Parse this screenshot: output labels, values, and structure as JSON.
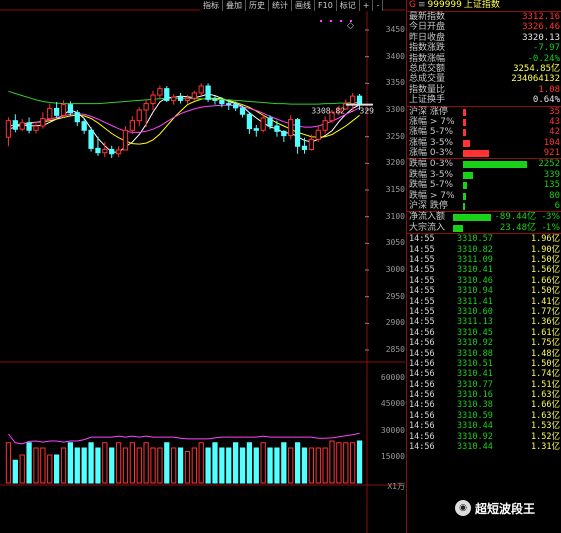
{
  "toolbar": [
    "指标",
    "叠加",
    "历史",
    "统计",
    "画线",
    "F10",
    "标记",
    "+",
    "-"
  ],
  "y_axis_main": [
    "3450",
    "3400",
    "3350",
    "3300",
    "3250",
    "3200",
    "3150",
    "3100",
    "3050",
    "3000",
    "2950",
    "2900",
    "2850"
  ],
  "y_axis_volume": [
    "60000",
    "45000",
    "30000",
    "15000",
    "X1万"
  ],
  "last_price_tag": "3308.82 - 329",
  "header": {
    "marker": "G",
    "code": "999999",
    "name": "上证指数"
  },
  "stats": [
    {
      "label": "最新指数",
      "value": "3312.16",
      "color": "red"
    },
    {
      "label": "今日开盘",
      "value": "3326.46",
      "color": "red"
    },
    {
      "label": "昨日收盘",
      "value": "3320.13",
      "color": "wht"
    },
    {
      "label": "指数涨跌",
      "value": "-7.97",
      "color": "grn"
    },
    {
      "label": "指数涨幅",
      "value": "-0.24%",
      "color": "grn"
    },
    {
      "label": "总成交额",
      "value": "3254.85亿",
      "color": "yel"
    },
    {
      "label": "总成交量",
      "value": "234064132",
      "color": "yel"
    },
    {
      "label": "指数量比",
      "value": "1.08",
      "color": "red"
    },
    {
      "label": "上证换手",
      "value": "0.64%",
      "color": "wht"
    }
  ],
  "breadth_up": [
    {
      "label": "沪深 涨停",
      "value": "35",
      "level": 0.04
    },
    {
      "label": "涨幅 > 7%",
      "value": "43",
      "level": 0.05
    },
    {
      "label": "涨幅 5-7%",
      "value": "42",
      "level": 0.05
    },
    {
      "label": "涨幅 3-5%",
      "value": "104",
      "level": 0.11
    },
    {
      "label": "涨幅 0-3%",
      "value": "921",
      "level": 0.41
    }
  ],
  "breadth_down": [
    {
      "label": "跌幅 0-3%",
      "value": "2252",
      "level": 1.0
    },
    {
      "label": "跌幅 3-5%",
      "value": "339",
      "level": 0.15
    },
    {
      "label": "跌幅 5-7%",
      "value": "135",
      "level": 0.06
    },
    {
      "label": "跌幅 > 7%",
      "value": "80",
      "level": 0.04
    },
    {
      "label": "沪深 跌停",
      "value": "6",
      "level": 0.01
    }
  ],
  "flows": [
    {
      "label": "净流入额",
      "value": "-89.44亿",
      "pct": "-3%",
      "level": 1.0
    },
    {
      "label": "大宗流入",
      "value": "23.48亿",
      "pct": "-1%",
      "level": 0.27
    }
  ],
  "ticks": [
    {
      "time": "14:55",
      "price": "3310.57",
      "vol": "1.96亿"
    },
    {
      "time": "14:55",
      "price": "3310.82",
      "vol": "1.90亿"
    },
    {
      "time": "14:55",
      "price": "3311.09",
      "vol": "1.50亿"
    },
    {
      "time": "14:55",
      "price": "3310.41",
      "vol": "1.56亿"
    },
    {
      "time": "14:55",
      "price": "3310.46",
      "vol": "1.66亿"
    },
    {
      "time": "14:55",
      "price": "3310.94",
      "vol": "1.50亿"
    },
    {
      "time": "14:55",
      "price": "3311.41",
      "vol": "1.41亿"
    },
    {
      "time": "14:55",
      "price": "3310.60",
      "vol": "1.77亿"
    },
    {
      "time": "14:55",
      "price": "3311.13",
      "vol": "1.36亿"
    },
    {
      "time": "14:56",
      "price": "3310.45",
      "vol": "1.61亿"
    },
    {
      "time": "14:56",
      "price": "3310.92",
      "vol": "1.75亿"
    },
    {
      "time": "14:56",
      "price": "3310.88",
      "vol": "1.48亿"
    },
    {
      "time": "14:56",
      "price": "3310.51",
      "vol": "1.50亿"
    },
    {
      "time": "14:56",
      "price": "3310.41",
      "vol": "1.74亿"
    },
    {
      "time": "14:56",
      "price": "3310.77",
      "vol": "1.51亿"
    },
    {
      "time": "14:56",
      "price": "3310.16",
      "vol": "1.63亿"
    },
    {
      "time": "14:56",
      "price": "3310.38",
      "vol": "1.66亿"
    },
    {
      "time": "14:56",
      "price": "3310.59",
      "vol": "1.63亿"
    },
    {
      "time": "14:56",
      "price": "3310.44",
      "vol": "1.53亿"
    },
    {
      "time": "14:56",
      "price": "3310.92",
      "vol": "1.52亿"
    },
    {
      "time": "14:56",
      "price": "3310.44",
      "vol": "1.31亿"
    }
  ],
  "watermark": "超短波段王",
  "colors": {
    "up": "#ff3333",
    "down": "#54ffff",
    "ma5": "#ffffff",
    "ma10": "#ffff00",
    "ma20": "#ff44ff",
    "ma60": "#33cc33",
    "grid": "#8a1010"
  },
  "chart_data": {
    "type": "candlestick",
    "price_range": [
      2850,
      3450
    ],
    "candles": [
      {
        "o": 3249,
        "c": 3280,
        "h": 3286,
        "l": 3232
      },
      {
        "o": 3280,
        "c": 3264,
        "h": 3292,
        "l": 3258
      },
      {
        "o": 3264,
        "c": 3276,
        "h": 3283,
        "l": 3260
      },
      {
        "o": 3276,
        "c": 3262,
        "h": 3286,
        "l": 3256
      },
      {
        "o": 3262,
        "c": 3270,
        "h": 3275,
        "l": 3256
      },
      {
        "o": 3270,
        "c": 3284,
        "h": 3296,
        "l": 3265
      },
      {
        "o": 3284,
        "c": 3303,
        "h": 3312,
        "l": 3280
      },
      {
        "o": 3303,
        "c": 3290,
        "h": 3315,
        "l": 3285
      },
      {
        "o": 3290,
        "c": 3310,
        "h": 3318,
        "l": 3286
      },
      {
        "o": 3310,
        "c": 3295,
        "h": 3316,
        "l": 3290
      },
      {
        "o": 3295,
        "c": 3278,
        "h": 3300,
        "l": 3270
      },
      {
        "o": 3278,
        "c": 3262,
        "h": 3285,
        "l": 3255
      },
      {
        "o": 3262,
        "c": 3228,
        "h": 3268,
        "l": 3222
      },
      {
        "o": 3228,
        "c": 3220,
        "h": 3250,
        "l": 3214
      },
      {
        "o": 3220,
        "c": 3226,
        "h": 3240,
        "l": 3212
      },
      {
        "o": 3226,
        "c": 3218,
        "h": 3233,
        "l": 3210
      },
      {
        "o": 3218,
        "c": 3225,
        "h": 3232,
        "l": 3212
      },
      {
        "o": 3225,
        "c": 3262,
        "h": 3270,
        "l": 3224
      },
      {
        "o": 3262,
        "c": 3280,
        "h": 3288,
        "l": 3255
      },
      {
        "o": 3280,
        "c": 3300,
        "h": 3305,
        "l": 3270
      },
      {
        "o": 3300,
        "c": 3312,
        "h": 3318,
        "l": 3268
      },
      {
        "o": 3312,
        "c": 3328,
        "h": 3336,
        "l": 3300
      },
      {
        "o": 3328,
        "c": 3340,
        "h": 3346,
        "l": 3322
      },
      {
        "o": 3340,
        "c": 3318,
        "h": 3345,
        "l": 3315
      },
      {
        "o": 3318,
        "c": 3324,
        "h": 3330,
        "l": 3310
      },
      {
        "o": 3324,
        "c": 3318,
        "h": 3332,
        "l": 3312
      },
      {
        "o": 3318,
        "c": 3322,
        "h": 3328,
        "l": 3312
      },
      {
        "o": 3322,
        "c": 3332,
        "h": 3336,
        "l": 3318
      },
      {
        "o": 3332,
        "c": 3345,
        "h": 3350,
        "l": 3326
      },
      {
        "o": 3345,
        "c": 3320,
        "h": 3350,
        "l": 3315
      },
      {
        "o": 3320,
        "c": 3318,
        "h": 3326,
        "l": 3310
      },
      {
        "o": 3318,
        "c": 3312,
        "h": 3324,
        "l": 3305
      },
      {
        "o": 3312,
        "c": 3310,
        "h": 3320,
        "l": 3300
      },
      {
        "o": 3310,
        "c": 3304,
        "h": 3316,
        "l": 3298
      },
      {
        "o": 3304,
        "c": 3292,
        "h": 3308,
        "l": 3286
      },
      {
        "o": 3292,
        "c": 3265,
        "h": 3296,
        "l": 3255
      },
      {
        "o": 3265,
        "c": 3262,
        "h": 3272,
        "l": 3250
      },
      {
        "o": 3262,
        "c": 3285,
        "h": 3292,
        "l": 3258
      },
      {
        "o": 3285,
        "c": 3270,
        "h": 3290,
        "l": 3264
      },
      {
        "o": 3270,
        "c": 3260,
        "h": 3280,
        "l": 3250
      },
      {
        "o": 3260,
        "c": 3252,
        "h": 3262,
        "l": 3240
      },
      {
        "o": 3252,
        "c": 3282,
        "h": 3290,
        "l": 3245
      },
      {
        "o": 3282,
        "c": 3232,
        "h": 3285,
        "l": 3218
      },
      {
        "o": 3232,
        "c": 3226,
        "h": 3248,
        "l": 3218
      },
      {
        "o": 3226,
        "c": 3245,
        "h": 3254,
        "l": 3224
      },
      {
        "o": 3245,
        "c": 3262,
        "h": 3270,
        "l": 3240
      },
      {
        "o": 3262,
        "c": 3280,
        "h": 3288,
        "l": 3256
      },
      {
        "o": 3280,
        "c": 3296,
        "h": 3300,
        "l": 3276
      },
      {
        "o": 3296,
        "c": 3302,
        "h": 3308,
        "l": 3290
      },
      {
        "o": 3302,
        "c": 3312,
        "h": 3320,
        "l": 3300
      },
      {
        "o": 3312,
        "c": 3326,
        "h": 3332,
        "l": 3300
      },
      {
        "o": 3326,
        "c": 3312,
        "h": 3330,
        "l": 3300
      }
    ],
    "volumes": [
      2.3,
      1.3,
      1.6,
      2.3,
      2.0,
      2.0,
      1.6,
      1.6,
      2.0,
      2.3,
      2.0,
      2.0,
      2.3,
      2.0,
      2.3,
      2.0,
      2.3,
      2.0,
      2.3,
      2.0,
      2.3,
      2.0,
      2.0,
      2.3,
      2.0,
      2.0,
      1.8,
      2.0,
      2.3,
      2.0,
      2.3,
      2.0,
      2.0,
      2.3,
      2.0,
      2.3,
      2.0,
      2.3,
      2.0,
      2.0,
      2.3,
      2.0,
      2.3,
      2.0,
      2.0,
      2.0,
      2.0,
      2.4,
      2.3,
      2.3,
      2.3,
      2.4
    ],
    "ma": {
      "ma5": [
        3262,
        3270,
        3272,
        3270,
        3271,
        3271,
        3277,
        3283,
        3291,
        3300,
        3295,
        3284,
        3265,
        3247,
        3233,
        3221,
        3221,
        3231,
        3240,
        3254,
        3273,
        3296,
        3315,
        3323,
        3324,
        3326,
        3325,
        3323,
        3326,
        3330,
        3327,
        3322,
        3316,
        3312,
        3307,
        3295,
        3285,
        3276,
        3268,
        3265,
        3257,
        3257,
        3250,
        3243,
        3240,
        3245,
        3252,
        3261,
        3278,
        3292,
        3303,
        3310
      ],
      "ma10": [
        3270,
        3272,
        3274,
        3276,
        3277,
        3278,
        3280,
        3283,
        3286,
        3289,
        3290,
        3289,
        3284,
        3276,
        3266,
        3256,
        3248,
        3242,
        3237,
        3236,
        3238,
        3244,
        3255,
        3270,
        3285,
        3298,
        3310,
        3316,
        3320,
        3322,
        3322,
        3321,
        3318,
        3314,
        3310,
        3305,
        3298,
        3290,
        3283,
        3276,
        3270,
        3264,
        3258,
        3254,
        3250,
        3249,
        3250,
        3254,
        3262,
        3270,
        3280,
        3290
      ],
      "ma20": [
        3265,
        3268,
        3271,
        3274,
        3277,
        3280,
        3283,
        3286,
        3289,
        3292,
        3293,
        3292,
        3288,
        3283,
        3277,
        3271,
        3265,
        3260,
        3258,
        3258,
        3260,
        3264,
        3270,
        3278,
        3286,
        3293,
        3298,
        3302,
        3305,
        3307,
        3308,
        3309,
        3309,
        3308,
        3306,
        3303,
        3299,
        3294,
        3288,
        3283,
        3278,
        3274,
        3270,
        3268,
        3268,
        3270,
        3274,
        3279,
        3285,
        3292,
        3298,
        3304
      ],
      "ma60": [
        3335,
        3331,
        3327,
        3323,
        3319,
        3316,
        3314,
        3313,
        3312,
        3312,
        3312,
        3312,
        3312,
        3312,
        3313,
        3314,
        3315,
        3316,
        3317,
        3318,
        3319,
        3320,
        3321,
        3322,
        3322,
        3322,
        3322,
        3321,
        3321,
        3320,
        3320,
        3319,
        3319,
        3318,
        3317,
        3316,
        3315,
        3314,
        3313,
        3312,
        3312,
        3311,
        3311,
        3311,
        3311,
        3311,
        3312,
        3312,
        3313,
        3313,
        3314,
        3314
      ]
    }
  }
}
